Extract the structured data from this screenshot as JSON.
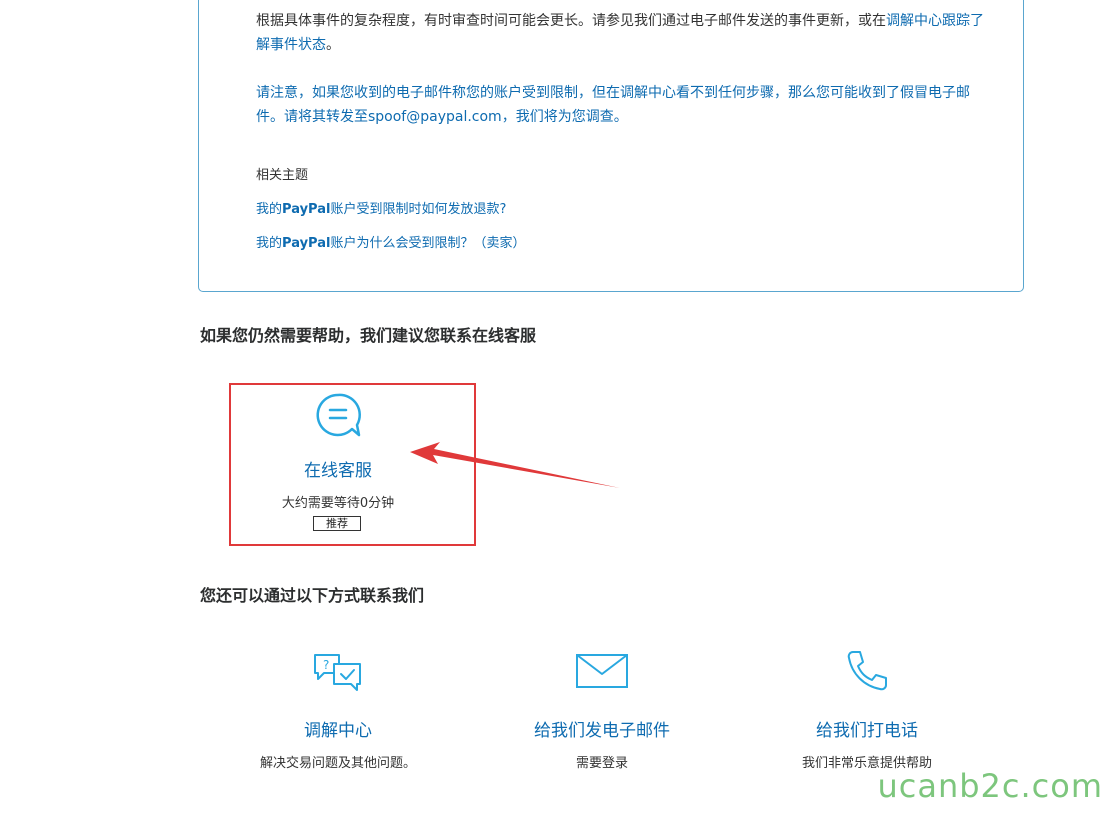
{
  "notice": {
    "para1_text": "根据具体事件的复杂程度，有时审查时间可能会更长。请参见我们通过电子邮件发送的事件更新，或在",
    "para1_link": "调解中心跟踪了解事件状态",
    "para1_end": "。",
    "para2": "请注意，如果您收到的电子邮件称您的账户受到限制，但在调解中心看不到任何步骤，那么您可能收到了假冒电子邮件。请将其转发至spoof@paypal.com，我们将为您调查。"
  },
  "related": {
    "title": "相关主题",
    "links": [
      {
        "pre": "我的",
        "brand": "PayPal",
        "post": "账户受到限制时如何发放退款?"
      },
      {
        "pre": "我的",
        "brand": "PayPal",
        "post": "账户为什么会受到限制？（卖家）"
      }
    ]
  },
  "help_section": {
    "title": "如果您仍然需要帮助，我们建议您联系在线客服",
    "chat": {
      "title": "在线客服",
      "wait": "大约需要等待0分钟",
      "badge": "推荐",
      "icon": "chat-bubble-icon"
    }
  },
  "contact_section": {
    "title": "您还可以通过以下方式联系我们",
    "options": [
      {
        "title": "调解中心",
        "desc": "解决交易问题及其他问题。",
        "icon": "resolution-center-icon"
      },
      {
        "title": "给我们发电子邮件",
        "desc": "需要登录",
        "icon": "email-icon"
      },
      {
        "title": "给我们打电话",
        "desc": "我们非常乐意提供帮助",
        "icon": "phone-icon"
      }
    ]
  },
  "watermark": "ucanb2c.com",
  "colors": {
    "link": "#0e6bb0",
    "icon": "#29a8e0",
    "highlight": "#e0393a",
    "card_border": "#5aa6cf"
  }
}
